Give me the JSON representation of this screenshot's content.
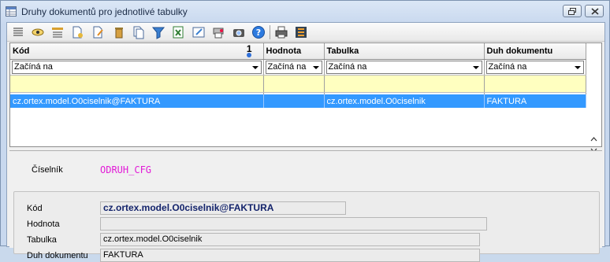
{
  "window": {
    "title": "Druhy dokumentů pro jednotlivé tabulky"
  },
  "toolbar": {
    "icons": [
      "list-icon",
      "view-icon",
      "filter-form-icon",
      "new-record-icon",
      "edit-record-icon",
      "delete-icon",
      "copy-record-icon",
      "filter-icon",
      "excel-export-icon",
      "edit-window-icon",
      "print-preview-icon",
      "camera-icon",
      "help-icon",
      "print-icon",
      "settings-icon"
    ]
  },
  "grid": {
    "columns": [
      {
        "label": "Kód",
        "sort_order": "1"
      },
      {
        "label": "Hodnota"
      },
      {
        "label": "Tabulka"
      },
      {
        "label": "Duh dokumentu"
      }
    ],
    "filters": [
      "Začíná na",
      "Začíná na",
      "Začíná na",
      "Začíná na"
    ],
    "rows": [
      {
        "kod": "cz.ortex.model.O0ciselnik@FAKTURA",
        "hodnota": "",
        "tabulka": "cz.ortex.model.O0ciselnik",
        "duh": "FAKTURA"
      }
    ],
    "selected_color": "#3399ff",
    "input_row_color": "#ffffc0"
  },
  "detail": {
    "ciselnik_label": "Číselník",
    "ciselnik_value": "ODRUH_CFG",
    "fields": [
      {
        "label": "Kód",
        "value": "cz.ortex.model.O0ciselnik@FAKTURA"
      },
      {
        "label": "Hodnota",
        "value": ""
      },
      {
        "label": "Tabulka",
        "value": "cz.ortex.model.O0ciselnik"
      },
      {
        "label": "Duh dokumentu",
        "value": "FAKTURA"
      }
    ]
  },
  "colors": {
    "ciselnik_value": "#e21bd7",
    "key_value": "#13236b"
  }
}
